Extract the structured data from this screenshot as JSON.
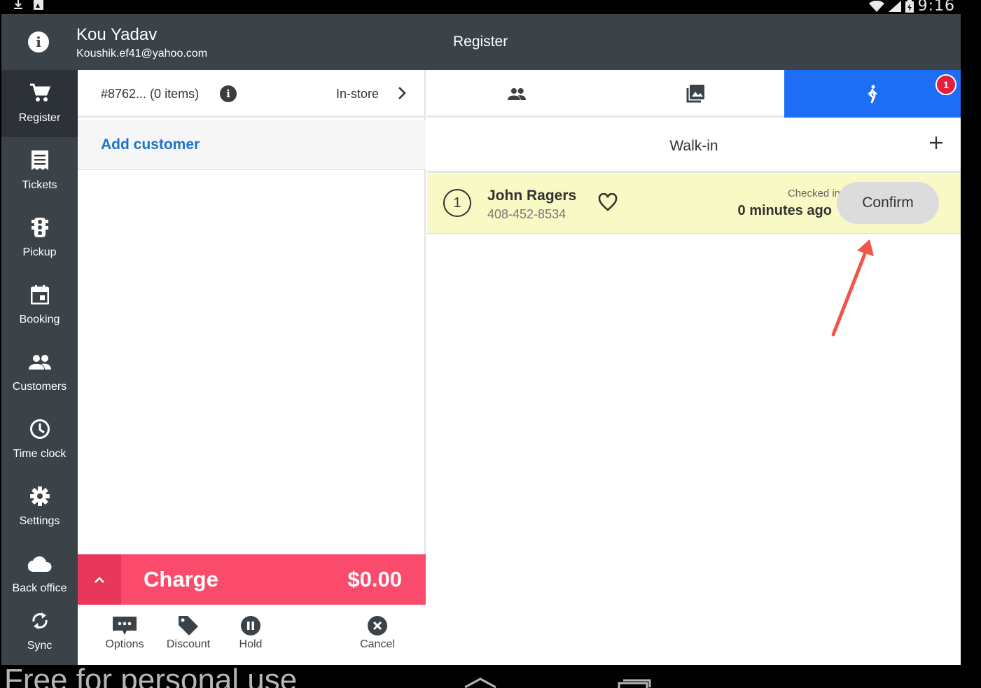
{
  "status_bar": {
    "time": "9:16",
    "left_icons": [
      "download-icon",
      "image-notification-icon"
    ],
    "right_icons": [
      "wifi-icon",
      "signal-icon",
      "battery-icon"
    ]
  },
  "header": {
    "user_name": "Kou Yadav",
    "user_email": "Koushik.ef41@yahoo.com",
    "title": "Register"
  },
  "sidebar": {
    "items": [
      {
        "label": "Register",
        "icon": "cart-icon",
        "active": true
      },
      {
        "label": "Tickets",
        "icon": "receipt-icon",
        "active": false
      },
      {
        "label": "Pickup",
        "icon": "traffic-light-icon",
        "active": false
      },
      {
        "label": "Booking",
        "icon": "calendar-icon",
        "active": false
      },
      {
        "label": "Customers",
        "icon": "people-icon",
        "active": false
      },
      {
        "label": "Time clock",
        "icon": "clock-icon",
        "active": false
      },
      {
        "label": "Settings",
        "icon": "gear-icon",
        "active": false
      },
      {
        "label": "Back office",
        "icon": "cloud-icon",
        "active": false
      },
      {
        "label": "Sync",
        "icon": "sync-icon",
        "active": false
      }
    ]
  },
  "order": {
    "id_text": "#8762... (0 items)",
    "type": "In-store",
    "add_customer": "Add customer",
    "charge_label": "Charge",
    "charge_amount": "$0.00"
  },
  "actions": [
    {
      "label": "Options",
      "icon": "more-icon"
    },
    {
      "label": "Discount",
      "icon": "tag-icon"
    },
    {
      "label": "Hold",
      "icon": "pause-icon"
    },
    {
      "label": "Cancel",
      "icon": "cancel-icon"
    }
  ],
  "tabs": [
    {
      "icon": "people-icon",
      "active": false
    },
    {
      "icon": "gallery-icon",
      "active": false
    },
    {
      "icon": "walk-icon",
      "active": true,
      "badge": "1"
    }
  ],
  "walkin": {
    "title": "Walk-in",
    "queue": [
      {
        "number": "1",
        "name": "John Ragers",
        "phone": "408-452-8534",
        "checked_label": "Checked in",
        "checked_ago": "0 minutes ago",
        "confirm_label": "Confirm"
      }
    ]
  },
  "watermark": "Free for personal use",
  "colors": {
    "sidebar_bg": "#3c4348",
    "accent_blue": "#1e6ef5",
    "charge_red": "#fb4b6c",
    "link_blue": "#1f73c9",
    "queue_row_bg": "#f8f9c4",
    "badge_red": "#e0203c",
    "arrow_red": "#f0554a"
  }
}
